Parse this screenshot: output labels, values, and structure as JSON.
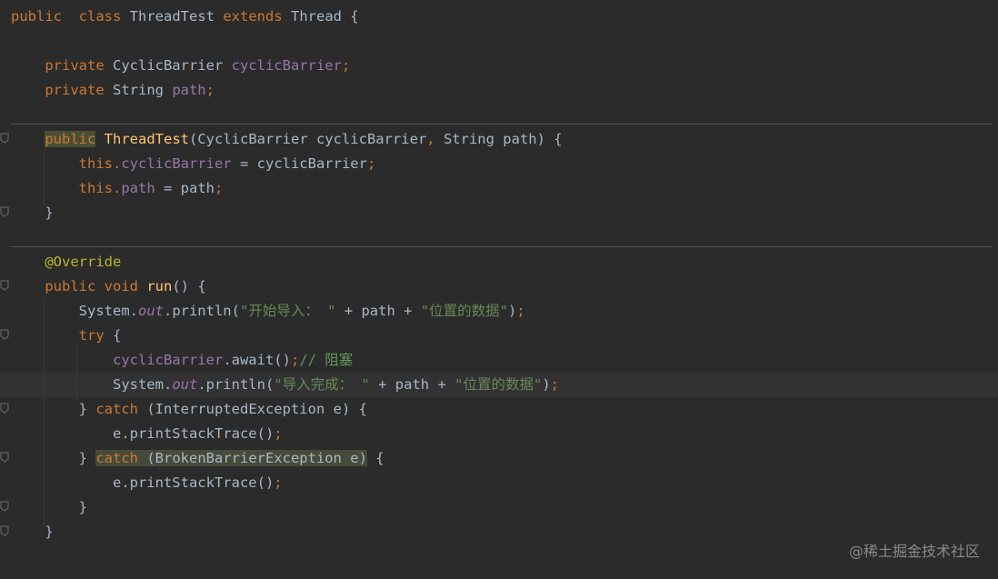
{
  "editor": {
    "lines": [
      {
        "id": "l1",
        "parts": [
          [
            "kw",
            "public"
          ],
          [
            "",
            "  "
          ],
          [
            "kw",
            "class"
          ],
          [
            "",
            " ThreadTest "
          ],
          [
            "kw",
            "extends"
          ],
          [
            "",
            " Thread {"
          ]
        ]
      },
      {
        "id": "l2",
        "parts": []
      },
      {
        "id": "l3",
        "parts": [
          [
            "",
            "    "
          ],
          [
            "kw",
            "private"
          ],
          [
            "",
            " CyclicBarrier "
          ],
          [
            "fld",
            "cyclicBarrier"
          ],
          [
            "kw",
            ";"
          ]
        ]
      },
      {
        "id": "l4",
        "parts": [
          [
            "",
            "    "
          ],
          [
            "kw",
            "private"
          ],
          [
            "",
            " String "
          ],
          [
            "fld",
            "path"
          ],
          [
            "kw",
            ";"
          ]
        ]
      },
      {
        "id": "l5",
        "parts": []
      },
      {
        "id": "l6",
        "parts": [
          [
            "",
            "    "
          ],
          [
            "kw hl",
            "public"
          ],
          [
            "",
            " "
          ],
          [
            "fn",
            "ThreadTest"
          ],
          [
            "",
            "(CyclicBarrier cyclicBarrier"
          ],
          [
            "kw",
            ","
          ],
          [
            "",
            " String path) {"
          ]
        ]
      },
      {
        "id": "l7",
        "parts": [
          [
            "",
            "        "
          ],
          [
            "kw",
            "this"
          ],
          [
            "kw",
            "."
          ],
          [
            "fld",
            "cyclicBarrier"
          ],
          [
            "",
            " = cyclicBarrier"
          ],
          [
            "kw",
            ";"
          ]
        ]
      },
      {
        "id": "l8",
        "parts": [
          [
            "",
            "        "
          ],
          [
            "kw",
            "this"
          ],
          [
            "kw",
            "."
          ],
          [
            "fld",
            "path"
          ],
          [
            "",
            " = path"
          ],
          [
            "kw",
            ";"
          ]
        ]
      },
      {
        "id": "l9",
        "parts": [
          [
            "",
            "    }"
          ]
        ]
      },
      {
        "id": "l10",
        "parts": []
      },
      {
        "id": "l11",
        "parts": [
          [
            "",
            "    "
          ],
          [
            "ann",
            "@Override"
          ]
        ]
      },
      {
        "id": "l12",
        "parts": [
          [
            "",
            "    "
          ],
          [
            "kw",
            "public"
          ],
          [
            "",
            " "
          ],
          [
            "kw",
            "void"
          ],
          [
            "",
            " "
          ],
          [
            "fn",
            "run"
          ],
          [
            "",
            "() {"
          ]
        ]
      },
      {
        "id": "l13",
        "parts": [
          [
            "",
            "        System."
          ],
          [
            "fld ital",
            "out"
          ],
          [
            "",
            ".println("
          ],
          [
            "str",
            "\"开始导入： \""
          ],
          [
            "",
            " + path + "
          ],
          [
            "str",
            "\"位置的数据\""
          ],
          [
            "",
            ")"
          ],
          [
            "kw",
            ";"
          ]
        ]
      },
      {
        "id": "l14",
        "parts": [
          [
            "",
            "        "
          ],
          [
            "kw",
            "try"
          ],
          [
            "",
            " {"
          ]
        ]
      },
      {
        "id": "l15",
        "parts": [
          [
            "",
            "            "
          ],
          [
            "fld",
            "cyclicBarrier"
          ],
          [
            "",
            ".await()"
          ],
          [
            "kw",
            ";"
          ],
          [
            "cmt",
            "// 阻塞"
          ]
        ]
      },
      {
        "id": "l16",
        "parts": [
          [
            "",
            "            System."
          ],
          [
            "fld ital",
            "out"
          ],
          [
            "",
            ".println("
          ],
          [
            "str",
            "\"导入完成： \""
          ],
          [
            "",
            " + path + "
          ],
          [
            "str",
            "\"位置的数据\""
          ],
          [
            "",
            ")"
          ],
          [
            "kw",
            ";"
          ]
        ]
      },
      {
        "id": "l17",
        "parts": [
          [
            "",
            "        } "
          ],
          [
            "kw",
            "catch"
          ],
          [
            "",
            " (InterruptedException e) {"
          ]
        ]
      },
      {
        "id": "l18",
        "parts": [
          [
            "",
            "            e.printStackTrace()"
          ],
          [
            "kw",
            ";"
          ]
        ]
      },
      {
        "id": "l19",
        "parts": [
          [
            "",
            "        } "
          ],
          [
            "kw hl2",
            "catch"
          ],
          [
            "hl2",
            " (BrokenBarrierException e)"
          ],
          [
            "",
            " {"
          ]
        ]
      },
      {
        "id": "l20",
        "parts": [
          [
            "",
            "            e.printStackTrace()"
          ],
          [
            "kw",
            ";"
          ]
        ]
      },
      {
        "id": "l21",
        "parts": [
          [
            "",
            "        }"
          ]
        ]
      },
      {
        "id": "l22",
        "parts": [
          [
            "",
            "    }"
          ]
        ]
      }
    ]
  },
  "watermark": "@稀土掘金技术社区"
}
